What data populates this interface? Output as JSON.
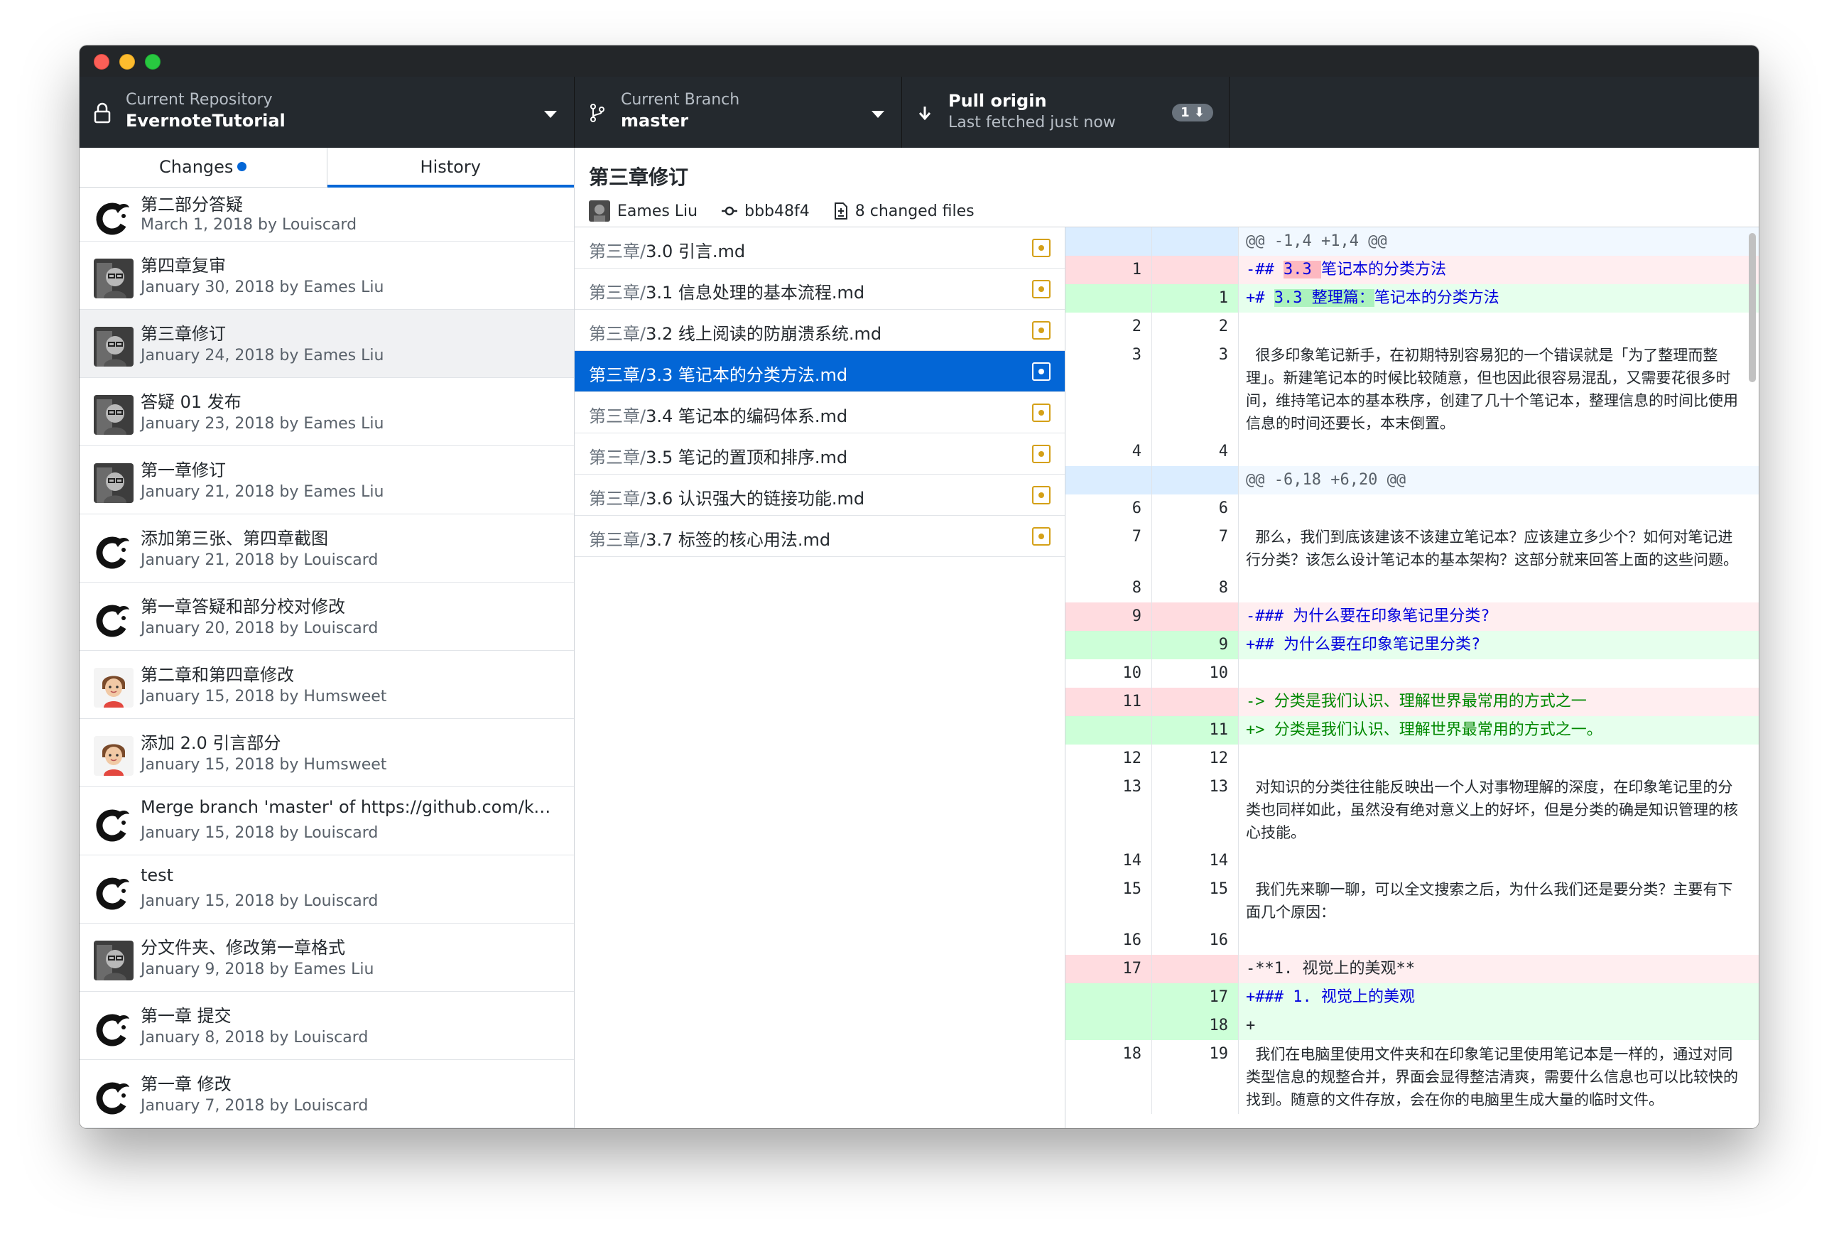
{
  "toolbar": {
    "repository": {
      "label": "Current Repository",
      "value": "EvernoteTutorial"
    },
    "branch": {
      "label": "Current Branch",
      "value": "master"
    },
    "pull": {
      "title": "Pull origin",
      "subtitle": "Last fetched just now",
      "badge": "1"
    }
  },
  "tabs": {
    "changes": "Changes",
    "history": "History"
  },
  "commits": [
    {
      "title": "第二部分答疑",
      "meta": "March 1, 2018 by Louiscard",
      "avatar": "louiscard"
    },
    {
      "title": "第四章复审",
      "meta": "January 30, 2018 by Eames Liu",
      "avatar": "eames"
    },
    {
      "title": "第三章修订",
      "meta": "January 24, 2018 by Eames Liu",
      "avatar": "eames"
    },
    {
      "title": "答疑 01 发布",
      "meta": "January 23, 2018 by Eames Liu",
      "avatar": "eames"
    },
    {
      "title": "第一章修订",
      "meta": "January 21, 2018 by Eames Liu",
      "avatar": "eames"
    },
    {
      "title": "添加第三张、第四章截图",
      "meta": "January 21, 2018 by Louiscard",
      "avatar": "louiscard"
    },
    {
      "title": "第一章答疑和部分校对修改",
      "meta": "January 20, 2018 by Louiscard",
      "avatar": "louiscard"
    },
    {
      "title": "第二章和第四章修改",
      "meta": "January 15, 2018 by Humsweet",
      "avatar": "humsweet"
    },
    {
      "title": "添加 2.0 引言部分",
      "meta": "January 15, 2018 by Humsweet",
      "avatar": "humsweet"
    },
    {
      "title": "Merge branch 'master' of https://github.com/kann…",
      "meta": "January 15, 2018 by Louiscard",
      "avatar": "louiscard"
    },
    {
      "title": "test",
      "meta": "January 15, 2018 by Louiscard",
      "avatar": "louiscard"
    },
    {
      "title": "分文件夹、修改第一章格式",
      "meta": "January 9, 2018 by Eames Liu",
      "avatar": "eames"
    },
    {
      "title": "第一章 提交",
      "meta": "January 8, 2018 by Louiscard",
      "avatar": "louiscard"
    },
    {
      "title": "第一章 修改",
      "meta": "January 7, 2018 by Louiscard",
      "avatar": "louiscard"
    }
  ],
  "selected_commit": {
    "title": "第三章修订",
    "author": "Eames Liu",
    "sha": "bbb48f4",
    "changed_files": "8 changed files"
  },
  "files": [
    {
      "dir": "第三章/",
      "name": "3.0 引言.md"
    },
    {
      "dir": "第三章/",
      "name": "3.1 信息处理的基本流程.md"
    },
    {
      "dir": "第三章/",
      "name": "3.2 线上阅读的防崩溃系统.md"
    },
    {
      "dir": "第三章/",
      "name": "3.3 笔记本的分类方法.md"
    },
    {
      "dir": "第三章/",
      "name": "3.4 笔记本的编码体系.md"
    },
    {
      "dir": "第三章/",
      "name": "3.5 笔记的置顶和排序.md"
    },
    {
      "dir": "第三章/",
      "name": "3.6 认识强大的链接功能.md"
    },
    {
      "dir": "第三章/",
      "name": "3.7 标签的核心用法.md"
    }
  ],
  "diff": [
    {
      "type": "hunk",
      "old": "",
      "new": "",
      "text": "@@ -1,4 +1,4 @@"
    },
    {
      "type": "del",
      "old": "1",
      "new": "",
      "parts": [
        [
          "-## ",
          ""
        ],
        [
          "3.3 ",
          "hl"
        ],
        [
          "笔记本的分类方法",
          ""
        ]
      ],
      "style": "md-h"
    },
    {
      "type": "add",
      "old": "",
      "new": "1",
      "parts": [
        [
          "+# ",
          ""
        ],
        [
          "3.3 整理篇：",
          "hl"
        ],
        [
          "笔记本的分类方法",
          ""
        ]
      ],
      "style": "md-h"
    },
    {
      "type": "ctx",
      "old": "2",
      "new": "2",
      "text": ""
    },
    {
      "type": "ctx",
      "old": "3",
      "new": "3",
      "text": "  很多印象笔记新手，在初期特别容易犯的一个错误就是「为了整理而整理」。新建笔记本的时候比较随意，但也因此很容易混乱，又需要花很多时间，维持笔记本的基本秩序，创建了几十个笔记本，整理信息的时间比使用信息的时间还要长，本末倒置。"
    },
    {
      "type": "ctx",
      "old": "4",
      "new": "4",
      "text": ""
    },
    {
      "type": "hunk",
      "old": "",
      "new": "",
      "text": "@@ -6,18 +6,20 @@"
    },
    {
      "type": "ctx",
      "old": "6",
      "new": "6",
      "text": ""
    },
    {
      "type": "ctx",
      "old": "7",
      "new": "7",
      "text": "  那么，我们到底该建该不该建立笔记本？应该建立多少个？如何对笔记进行分类？该怎么设计笔记本的基本架构？这部分就来回答上面的这些问题。"
    },
    {
      "type": "ctx",
      "old": "8",
      "new": "8",
      "text": ""
    },
    {
      "type": "del",
      "old": "9",
      "new": "",
      "parts": [
        [
          "-### 为什么要在印象笔记里分类?",
          ""
        ]
      ],
      "style": "md-h"
    },
    {
      "type": "add",
      "old": "",
      "new": "9",
      "parts": [
        [
          "+## 为什么要在印象笔记里分类?",
          ""
        ]
      ],
      "style": "md-h"
    },
    {
      "type": "ctx",
      "old": "10",
      "new": "10",
      "text": ""
    },
    {
      "type": "del",
      "old": "11",
      "new": "",
      "parts": [
        [
          "-> 分类是我们认识、理解世界最常用的方式之一",
          ""
        ]
      ],
      "style": "md-q"
    },
    {
      "type": "add",
      "old": "",
      "new": "11",
      "parts": [
        [
          "+> 分类是我们认识、理解世界最常用的方式之一。",
          ""
        ]
      ],
      "style": "md-q"
    },
    {
      "type": "ctx",
      "old": "12",
      "new": "12",
      "text": ""
    },
    {
      "type": "ctx",
      "old": "13",
      "new": "13",
      "text": "  对知识的分类往往能反映出一个人对事物理解的深度，在印象笔记里的分类也同样如此，虽然没有绝对意义上的好坏，但是分类的确是知识管理的核心技能。"
    },
    {
      "type": "ctx",
      "old": "14",
      "new": "14",
      "text": ""
    },
    {
      "type": "ctx",
      "old": "15",
      "new": "15",
      "text": "  我们先来聊一聊，可以全文搜索之后，为什么我们还是要分类？主要有下面几个原因："
    },
    {
      "type": "ctx",
      "old": "16",
      "new": "16",
      "text": ""
    },
    {
      "type": "del",
      "old": "17",
      "new": "",
      "parts": [
        [
          "-**1. 视觉上的美观**",
          ""
        ]
      ],
      "style": ""
    },
    {
      "type": "add",
      "old": "",
      "new": "17",
      "parts": [
        [
          "+### 1. 视觉上的美观",
          ""
        ]
      ],
      "style": "md-h"
    },
    {
      "type": "add",
      "old": "",
      "new": "18",
      "parts": [
        [
          "+",
          ""
        ]
      ],
      "style": ""
    },
    {
      "type": "ctx",
      "old": "18",
      "new": "19",
      "text": "  我们在电脑里使用文件夹和在印象笔记里使用笔记本是一样的，通过对同类型信息的规整合并，界面会显得整洁清爽，需要什么信息也可以比较快的找到。随意的文件存放，会在你的电脑里生成大量的临时文件。"
    }
  ]
}
